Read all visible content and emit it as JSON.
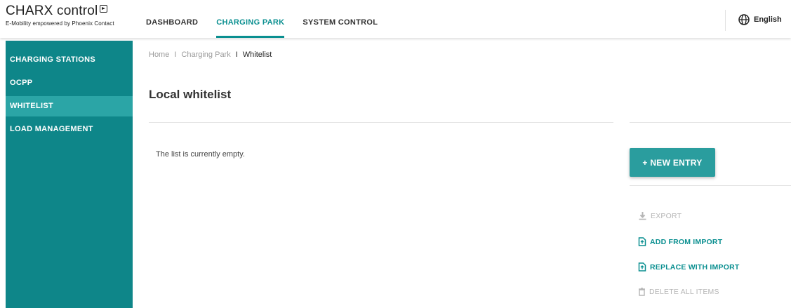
{
  "brand": {
    "title": "CHARX control",
    "subtitle": "E-Mobility empowered by Phoenix Contact"
  },
  "topnav": {
    "items": [
      {
        "label": "DASHBOARD",
        "active": false
      },
      {
        "label": "CHARGING PARK",
        "active": true
      },
      {
        "label": "SYSTEM CONTROL",
        "active": false
      }
    ],
    "language": "English"
  },
  "sidebar": {
    "items": [
      {
        "label": "CHARGING STATIONS",
        "active": false
      },
      {
        "label": "OCPP",
        "active": false
      },
      {
        "label": "WHITELIST",
        "active": true
      },
      {
        "label": "LOAD MANAGEMENT",
        "active": false
      }
    ]
  },
  "breadcrumb": {
    "items": [
      "Home",
      "Charging Park",
      "Whitelist"
    ],
    "separator": "I"
  },
  "main": {
    "title": "Local whitelist",
    "empty_message": "The list is currently empty."
  },
  "actions": {
    "new_entry": "+ NEW ENTRY",
    "export": "EXPORT",
    "add_from_import": "ADD FROM IMPORT",
    "replace_with_import": "REPLACE WITH IMPORT",
    "delete_all": "DELETE ALL ITEMS"
  },
  "colors": {
    "accent": "#0a8f90",
    "sidebar_bg": "#0e8689",
    "sidebar_active": "#2ba5a6",
    "button_bg": "#2a9d9e",
    "disabled": "#b5b5b5"
  }
}
